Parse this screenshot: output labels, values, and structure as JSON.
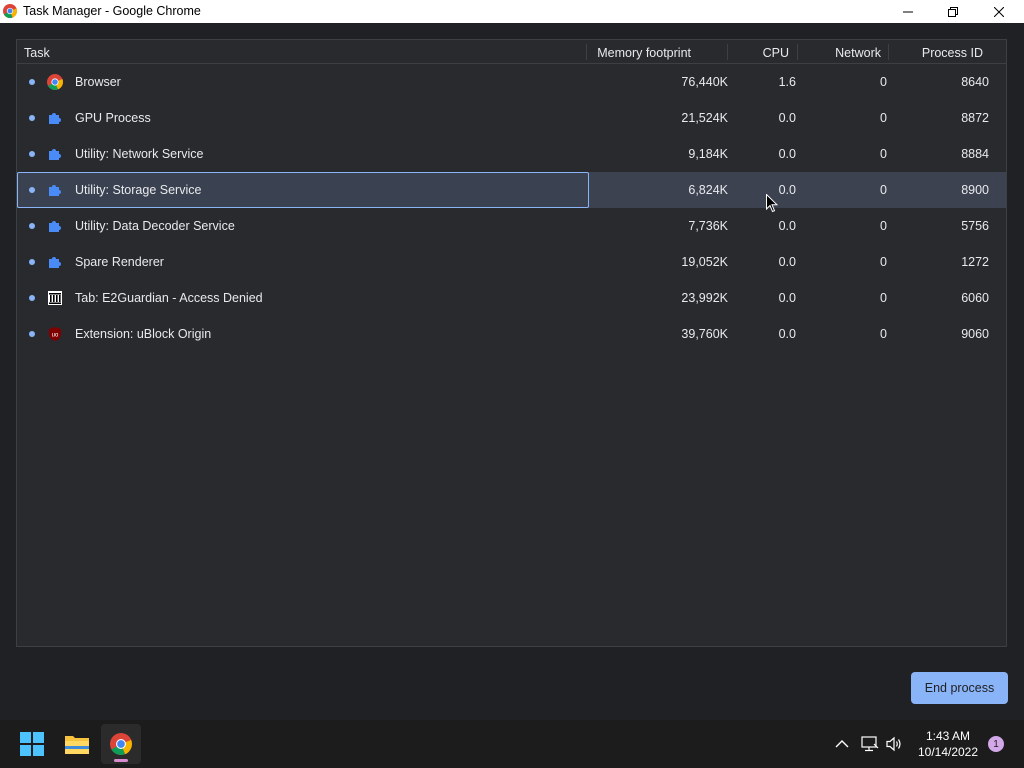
{
  "window": {
    "title": "Task Manager - Google Chrome"
  },
  "table": {
    "headers": {
      "task": "Task",
      "memory": "Memory footprint",
      "cpu": "CPU",
      "network": "Network",
      "pid": "Process ID"
    },
    "rows": [
      {
        "name": "Browser",
        "icon": "chrome-icon",
        "memory": "76,440K",
        "cpu": "1.6",
        "network": "0",
        "pid": "8640"
      },
      {
        "name": "GPU Process",
        "icon": "puzzle-icon",
        "memory": "21,524K",
        "cpu": "0.0",
        "network": "0",
        "pid": "8872"
      },
      {
        "name": "Utility: Network Service",
        "icon": "puzzle-icon",
        "memory": "9,184K",
        "cpu": "0.0",
        "network": "0",
        "pid": "8884"
      },
      {
        "name": "Utility: Storage Service",
        "icon": "puzzle-icon",
        "memory": "6,824K",
        "cpu": "0.0",
        "network": "0",
        "pid": "8900",
        "selected": true
      },
      {
        "name": "Utility: Data Decoder Service",
        "icon": "puzzle-icon",
        "memory": "7,736K",
        "cpu": "0.0",
        "network": "0",
        "pid": "5756"
      },
      {
        "name": "Spare Renderer",
        "icon": "puzzle-icon",
        "memory": "19,052K",
        "cpu": "0.0",
        "network": "0",
        "pid": "1272"
      },
      {
        "name": "Tab: E2Guardian - Access Denied",
        "icon": "building-icon",
        "memory": "23,992K",
        "cpu": "0.0",
        "network": "0",
        "pid": "6060"
      },
      {
        "name": "Extension: uBlock Origin",
        "icon": "ublock-icon",
        "memory": "39,760K",
        "cpu": "0.0",
        "network": "0",
        "pid": "9060"
      }
    ]
  },
  "actions": {
    "end_process": "End process"
  },
  "taskbar": {
    "time": "1:43 AM",
    "date": "10/14/2022",
    "notification_count": "1"
  },
  "colors": {
    "accent": "#8ab4f8",
    "background": "#202124",
    "panel": "#292a2d",
    "selected_row": "#3c4250"
  }
}
